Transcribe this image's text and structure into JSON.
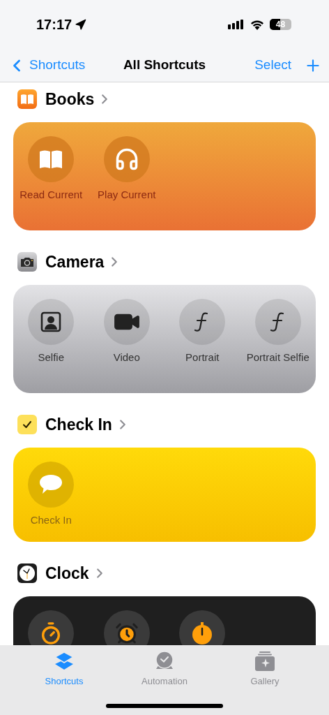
{
  "status_bar": {
    "time": "17:17",
    "battery": "48"
  },
  "nav": {
    "back": "Shortcuts",
    "title": "All Shortcuts",
    "select": "Select"
  },
  "sections": [
    {
      "kind": "books",
      "title": "Books",
      "tiles": [
        {
          "kind": "book",
          "label": "Read Current"
        },
        {
          "kind": "headphones",
          "label": "Play Current"
        }
      ]
    },
    {
      "kind": "camera",
      "title": "Camera",
      "tiles": [
        {
          "kind": "portrait",
          "label": "Selfie"
        },
        {
          "kind": "video",
          "label": "Video"
        },
        {
          "kind": "aperture",
          "label": "Portrait"
        },
        {
          "kind": "aperture",
          "label": "Portrait Selfie"
        }
      ]
    },
    {
      "kind": "checkin",
      "title": "Check In",
      "tiles": [
        {
          "kind": "bubble",
          "label": "Check In"
        }
      ]
    },
    {
      "kind": "clock",
      "title": "Clock",
      "tiles": [
        {
          "kind": "timer"
        },
        {
          "kind": "alarm"
        },
        {
          "kind": "stopwatch"
        }
      ]
    }
  ],
  "tabs": [
    {
      "kind": "layers",
      "label": "Shortcuts",
      "selected": true
    },
    {
      "kind": "automation",
      "label": "Automation",
      "selected": false
    },
    {
      "kind": "gallery",
      "label": "Gallery",
      "selected": false
    }
  ]
}
